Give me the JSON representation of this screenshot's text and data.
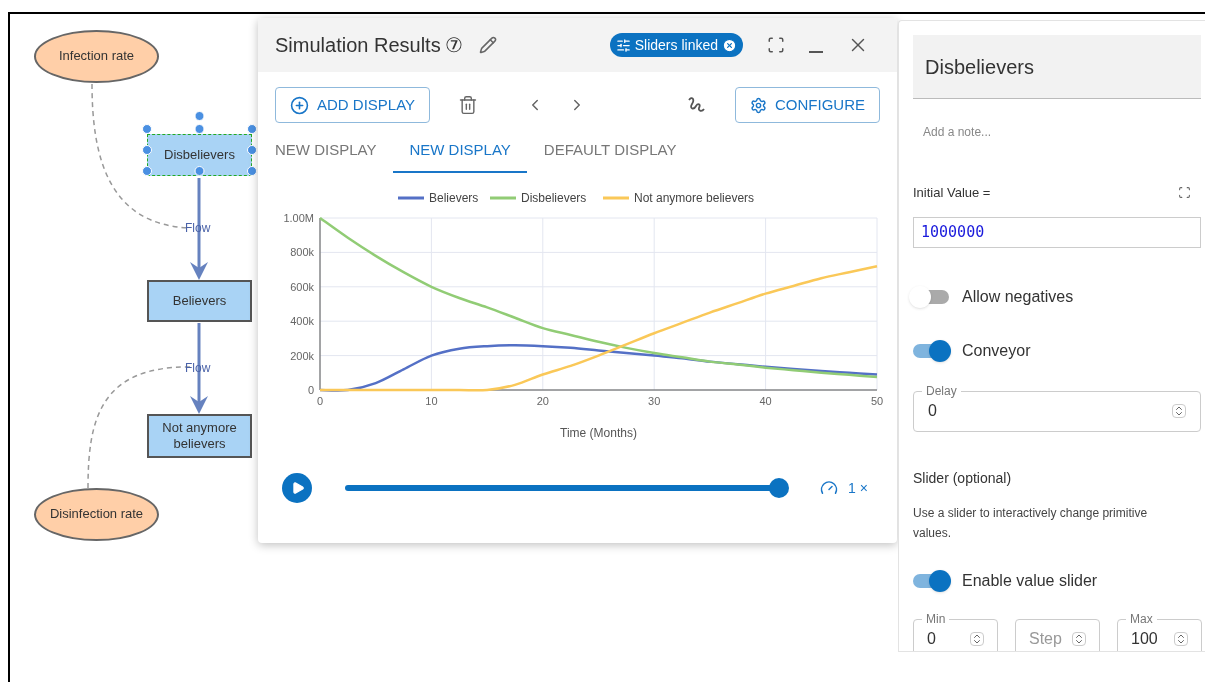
{
  "diagram": {
    "nodes": [
      {
        "kind": "variable",
        "label": "Infection rate"
      },
      {
        "kind": "stock",
        "label": "Disbelievers",
        "selected": true
      },
      {
        "kind": "stock",
        "label": "Believers",
        "selected": false
      },
      {
        "kind": "stock",
        "label": "Not anymore believers",
        "selected": false
      },
      {
        "kind": "variable",
        "label": "Disinfection rate"
      }
    ],
    "flows": [
      {
        "label": "Flow"
      },
      {
        "label": "Flow"
      }
    ]
  },
  "results_window": {
    "title": "Simulation Results",
    "badge": "⑦",
    "chip": "Sliders linked",
    "add_button": "ADD DISPLAY",
    "configure_button": "CONFIGURE",
    "tabs": [
      {
        "label": "NEW DISPLAY",
        "selected": false
      },
      {
        "label": "NEW DISPLAY",
        "selected": true
      },
      {
        "label": "DEFAULT DISPLAY",
        "selected": false
      }
    ],
    "chart_data": {
      "type": "line",
      "xlabel": "Time (Months)",
      "x": [
        0,
        2.5,
        5,
        7.5,
        10,
        12.5,
        15,
        17.5,
        20,
        22.5,
        25,
        27.5,
        30,
        32.5,
        35,
        37.5,
        40,
        42.5,
        45,
        47.5,
        50
      ],
      "series": [
        {
          "name": "Believers",
          "color": "#5470c6",
          "values": [
            0,
            0,
            40000,
            120000,
            200000,
            240000,
            255000,
            260000,
            255000,
            245000,
            230000,
            215000,
            200000,
            185000,
            165000,
            150000,
            135000,
            122000,
            110000,
            100000,
            90000
          ]
        },
        {
          "name": "Disbelievers",
          "color": "#91cc75",
          "values": [
            1000000,
            885000,
            780000,
            685000,
            600000,
            535000,
            480000,
            420000,
            360000,
            320000,
            280000,
            245000,
            215000,
            190000,
            165000,
            148000,
            130000,
            115000,
            100000,
            88000,
            75000
          ]
        },
        {
          "name": "Not anymore believers",
          "color": "#fac858",
          "values": [
            0,
            0,
            0,
            0,
            0,
            0,
            0,
            30000,
            90000,
            140000,
            200000,
            265000,
            330000,
            390000,
            450000,
            505000,
            560000,
            605000,
            650000,
            685000,
            720000
          ]
        }
      ],
      "grid": true,
      "legend": true,
      "xlim": [
        0,
        50
      ],
      "ylim": [
        0,
        1000000
      ],
      "xticks": [
        0,
        10,
        20,
        30,
        40,
        50
      ],
      "yticks": [
        {
          "value": 0,
          "label": "0"
        },
        {
          "value": 200000,
          "label": "200k"
        },
        {
          "value": 400000,
          "label": "400k"
        },
        {
          "value": 600000,
          "label": "600k"
        },
        {
          "value": 800000,
          "label": "800k"
        },
        {
          "value": 1000000,
          "label": "1.00M"
        }
      ]
    },
    "playback": {
      "level": 1,
      "speed": "1 ×"
    }
  },
  "properties": {
    "title": "Disbelievers",
    "note_placeholder": "Add a note...",
    "initial_value_label": "Initial Value =",
    "initial_value": "1000000",
    "toggles": [
      {
        "label": "Allow negatives",
        "on": false
      },
      {
        "label": "Conveyor",
        "on": true
      }
    ],
    "delay": {
      "label": "Delay",
      "value": "0"
    },
    "slider_heading": "Slider (optional)",
    "slider_help": "Use a slider to interactively change primitive values.",
    "slider_toggle": {
      "label": "Enable value slider",
      "on": true
    },
    "slider_fields": [
      {
        "label": "Min",
        "value": "0"
      },
      {
        "placeholder": "Step"
      },
      {
        "label": "Max",
        "value": "100"
      }
    ]
  }
}
